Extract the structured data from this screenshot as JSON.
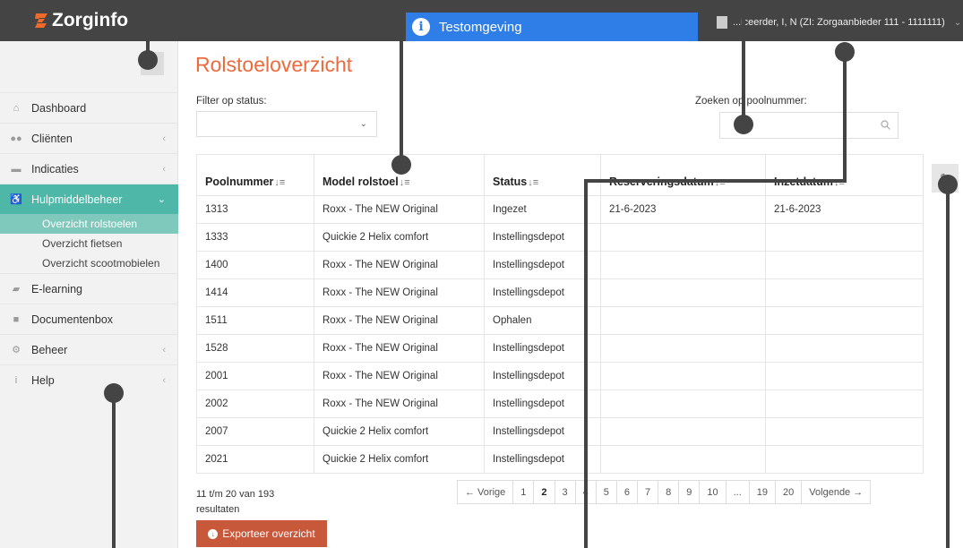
{
  "app": {
    "name": "Zorginfo"
  },
  "environment": {
    "label": "Testomgeving"
  },
  "user": {
    "label": "...iceerder, I, N (ZI: Zorgaanbieder 111 - 1111111)"
  },
  "sidebar": {
    "items": [
      {
        "label": "Dashboard",
        "icon": "home-icon"
      },
      {
        "label": "Cliënten",
        "icon": "users-icon",
        "arrow": "‹"
      },
      {
        "label": "Indicaties",
        "icon": "briefcase-icon",
        "arrow": "‹"
      },
      {
        "label": "Hulpmiddelbeheer",
        "icon": "wheelchair-icon",
        "arrow": "⌄"
      },
      {
        "label": "E-learning",
        "icon": "book-icon"
      },
      {
        "label": "Documentenbox",
        "icon": "archive-icon"
      },
      {
        "label": "Beheer",
        "icon": "cogs-icon",
        "arrow": "‹"
      },
      {
        "label": "Help",
        "icon": "info-icon",
        "arrow": "‹"
      }
    ],
    "subitems": [
      {
        "label": "Overzicht rolstoelen"
      },
      {
        "label": "Overzicht fietsen"
      },
      {
        "label": "Overzicht scootmobielen"
      }
    ]
  },
  "page": {
    "title": "Rolstoeloverzicht",
    "filter_label": "Filter op status:",
    "search_label": "Zoeken op poolnummer:"
  },
  "table": {
    "columns": [
      "Poolnummer",
      "Model rolstoel",
      "Status",
      "Reserveringsdatum",
      "Inzetdatum"
    ],
    "rows": [
      [
        "1313",
        "Roxx - The NEW Original",
        "Ingezet",
        "21-6-2023",
        "21-6-2023"
      ],
      [
        "1333",
        "Quickie 2 Helix comfort",
        "Instellingsdepot",
        "",
        ""
      ],
      [
        "1400",
        "Roxx - The NEW Original",
        "Instellingsdepot",
        "",
        ""
      ],
      [
        "1414",
        "Roxx - The NEW Original",
        "Instellingsdepot",
        "",
        ""
      ],
      [
        "1511",
        "Roxx - The NEW Original",
        "Ophalen",
        "",
        ""
      ],
      [
        "1528",
        "Roxx - The NEW Original",
        "Instellingsdepot",
        "",
        ""
      ],
      [
        "2001",
        "Roxx - The NEW Original",
        "Instellingsdepot",
        "",
        ""
      ],
      [
        "2002",
        "Roxx - The NEW Original",
        "Instellingsdepot",
        "",
        ""
      ],
      [
        "2007",
        "Quickie 2 Helix comfort",
        "Instellingsdepot",
        "",
        ""
      ],
      [
        "2021",
        "Quickie 2 Helix comfort",
        "Instellingsdepot",
        "",
        ""
      ]
    ]
  },
  "footer": {
    "results": "11 t/m 20 van 193 resultaten",
    "export_label": "Exporteer overzicht",
    "pagination": [
      "← Vorige",
      "1",
      "2",
      "3",
      "4",
      "5",
      "6",
      "7",
      "8",
      "9",
      "10",
      "...",
      "19",
      "20",
      "Volgende →"
    ],
    "current_page": "2"
  },
  "colors": {
    "accent": "#ec6a3c",
    "teal": "#4eb7a7",
    "topbar": "#444444",
    "env_banner": "#2f7ee8",
    "export": "#c8583a"
  }
}
